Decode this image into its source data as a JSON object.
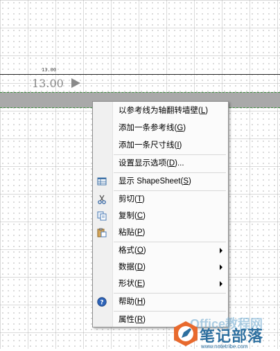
{
  "canvas": {
    "dimension_small": "13.00",
    "dimension_large": "13.00"
  },
  "context_menu": {
    "items": [
      {
        "label": "以参考线为轴翻转墙壁(L)",
        "underline_key": "L",
        "icon": "",
        "submenu": false
      },
      {
        "label": "添加一条参考线(G)",
        "underline_key": "G",
        "icon": "",
        "submenu": false
      },
      {
        "label": "添加一条尺寸线(I)",
        "underline_key": "I",
        "icon": "",
        "submenu": false
      },
      {
        "label": "设置显示选项(D)...",
        "underline_key": "D",
        "icon": "",
        "submenu": false
      },
      {
        "label": "显示 ShapeSheet(S)",
        "underline_key": "S",
        "icon": "shapesheet-icon",
        "submenu": false
      },
      {
        "label": "剪切(T)",
        "underline_key": "T",
        "icon": "scissors-icon",
        "submenu": false
      },
      {
        "label": "复制(C)",
        "underline_key": "C",
        "icon": "copy-icon",
        "submenu": false
      },
      {
        "label": "粘贴(P)",
        "underline_key": "P",
        "icon": "paste-icon",
        "submenu": false
      },
      {
        "label": "格式(O)",
        "underline_key": "O",
        "icon": "",
        "submenu": true
      },
      {
        "label": "数据(D)",
        "underline_key": "D",
        "icon": "",
        "submenu": true
      },
      {
        "label": "形状(E)",
        "underline_key": "E",
        "icon": "",
        "submenu": true
      },
      {
        "label": "帮助(H)",
        "underline_key": "H",
        "icon": "help-icon",
        "submenu": false
      },
      {
        "label": "属性(R)",
        "underline_key": "R",
        "icon": "",
        "submenu": false
      }
    ]
  },
  "watermark": {
    "title": "笔记部落",
    "url": "www.notetribe.com",
    "bg_text": "Office教程网"
  }
}
